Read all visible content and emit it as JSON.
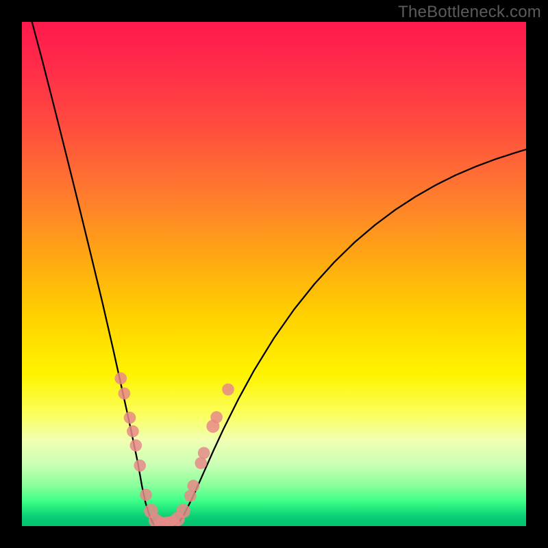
{
  "watermark": "TheBottleneck.com",
  "colors": {
    "frame": "#000000",
    "curve": "#000000",
    "markers": "#e88a88",
    "gradient_top": "#ff1a4d",
    "gradient_bottom": "#05c470"
  },
  "chart_data": {
    "type": "line",
    "title": "",
    "xlabel": "",
    "ylabel": "",
    "xlim": [
      0,
      100
    ],
    "ylim": [
      0,
      100
    ],
    "grid": false,
    "legend": false,
    "note": "Axes have no visible tick labels; x and y normalized to 0–100 of the plot area. y=0 is bottom (green), y=100 is top (red). Values estimated from pixels.",
    "series": [
      {
        "name": "left-branch",
        "x": [
          2,
          4,
          6,
          8,
          10,
          12,
          14,
          16,
          18,
          19,
          20,
          21,
          22,
          23,
          23.8,
          24.5,
          25.2,
          25.8,
          26.2,
          26.5
        ],
        "y": [
          100,
          92.5,
          84.7,
          76.8,
          68.8,
          60.7,
          52.5,
          44.2,
          35.5,
          31.0,
          26.5,
          22.0,
          17.3,
          12.5,
          8.0,
          4.7,
          2.4,
          1.0,
          0.3,
          0.1
        ]
      },
      {
        "name": "valley-floor",
        "x": [
          26.5,
          27.0,
          27.8,
          28.7,
          29.5,
          30.2,
          30.8
        ],
        "y": [
          0.1,
          0.0,
          0.0,
          0.0,
          0.0,
          0.05,
          0.2
        ]
      },
      {
        "name": "right-branch",
        "x": [
          30.8,
          32,
          34,
          36,
          38,
          40,
          43,
          46,
          50,
          54,
          58,
          62,
          66,
          70,
          74,
          78,
          82,
          86,
          90,
          94,
          98,
          100
        ],
        "y": [
          0.2,
          2.0,
          6.0,
          10.5,
          15.0,
          19.3,
          25.3,
          30.8,
          37.3,
          43.0,
          48.0,
          52.4,
          56.3,
          59.7,
          62.7,
          65.3,
          67.6,
          69.6,
          71.3,
          72.8,
          74.1,
          74.7
        ]
      }
    ],
    "markers": {
      "name": "dot-clusters",
      "note": "Salmon circular markers overlaid near the valley on both branches; values in same 0–100 coords; r is approximate radius in percent of plot width.",
      "points": [
        {
          "x": 19.6,
          "y": 29.3,
          "r": 1.2
        },
        {
          "x": 20.3,
          "y": 26.3,
          "r": 1.2
        },
        {
          "x": 21.4,
          "y": 21.5,
          "r": 1.2
        },
        {
          "x": 22.0,
          "y": 18.8,
          "r": 1.2
        },
        {
          "x": 22.6,
          "y": 16.0,
          "r": 1.2
        },
        {
          "x": 23.4,
          "y": 12.0,
          "r": 1.2
        },
        {
          "x": 24.6,
          "y": 6.2,
          "r": 1.2
        },
        {
          "x": 25.6,
          "y": 3.0,
          "r": 1.4
        },
        {
          "x": 26.5,
          "y": 1.1,
          "r": 1.4
        },
        {
          "x": 27.6,
          "y": 0.5,
          "r": 1.4
        },
        {
          "x": 28.8,
          "y": 0.5,
          "r": 1.4
        },
        {
          "x": 29.9,
          "y": 0.7,
          "r": 1.4
        },
        {
          "x": 30.9,
          "y": 1.4,
          "r": 1.4
        },
        {
          "x": 32.0,
          "y": 3.0,
          "r": 1.4
        },
        {
          "x": 33.4,
          "y": 6.0,
          "r": 1.2
        },
        {
          "x": 34.0,
          "y": 8.0,
          "r": 1.2
        },
        {
          "x": 35.5,
          "y": 12.5,
          "r": 1.2
        },
        {
          "x": 36.1,
          "y": 14.5,
          "r": 1.2
        },
        {
          "x": 37.9,
          "y": 19.8,
          "r": 1.3
        },
        {
          "x": 38.6,
          "y": 21.6,
          "r": 1.2
        },
        {
          "x": 40.9,
          "y": 27.1,
          "r": 1.2
        }
      ]
    }
  }
}
